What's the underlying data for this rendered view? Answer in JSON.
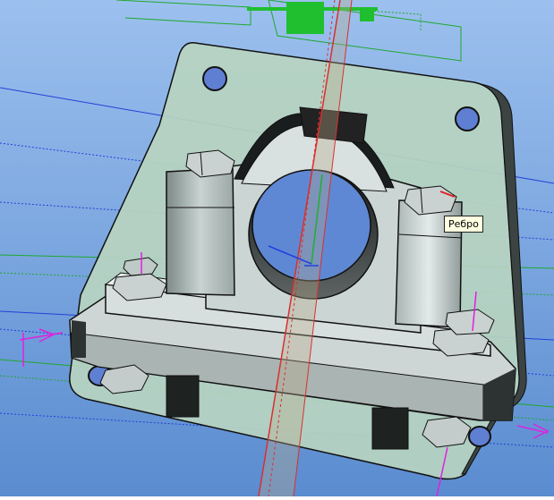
{
  "viewport": {
    "background_top": "#8fb6e6",
    "background_bottom": "#5f8fcf",
    "plate_color": "#b9d7c4",
    "part_light": "#dde6e4",
    "part_mid": "#bcc8c6",
    "part_dark": "#6f7a79",
    "edge_color": "#111111",
    "hole_color": "#5f7fd3",
    "ref_plane_color": "#e04040",
    "line_blue": "#1f3fd6",
    "line_green": "#1fae2f",
    "marker_magenta": "#e020e0"
  },
  "tooltip": {
    "text": "Ребро"
  }
}
